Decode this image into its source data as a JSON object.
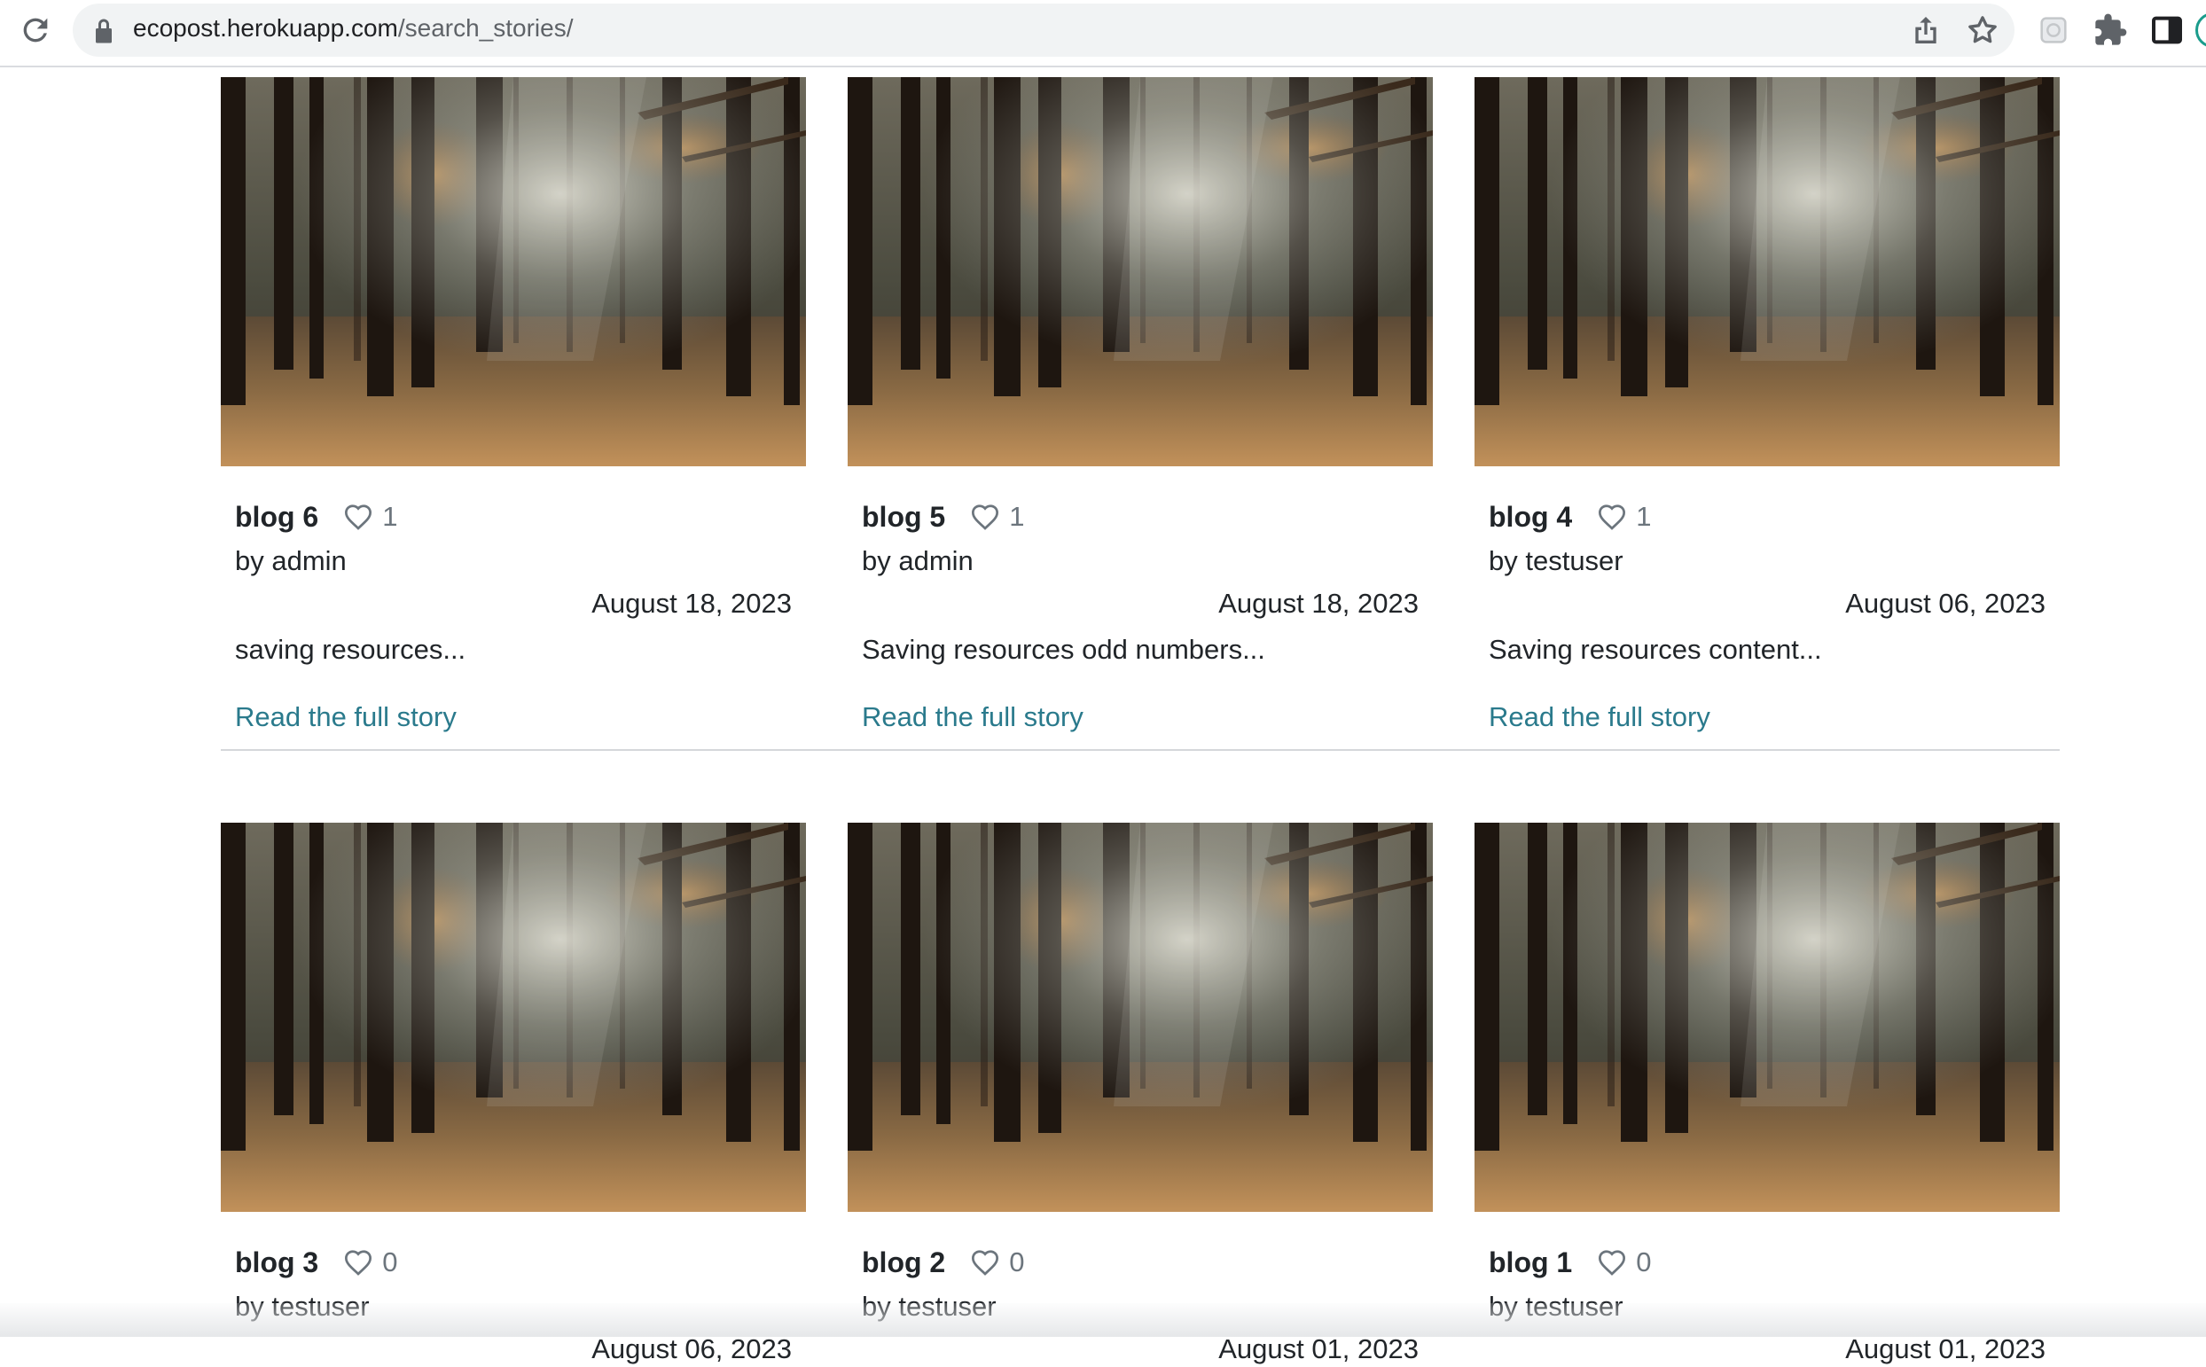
{
  "browser": {
    "url_host": "ecopost.herokuapp.com",
    "url_path": "/search_stories/"
  },
  "stories": [
    {
      "title": "blog 6",
      "likes": "1",
      "author": "by admin",
      "date": "August 18, 2023",
      "excerpt": "saving resources...",
      "link": "Read the full story"
    },
    {
      "title": "blog 5",
      "likes": "1",
      "author": "by admin",
      "date": "August 18, 2023",
      "excerpt": "Saving resources odd numbers...",
      "link": "Read the full story"
    },
    {
      "title": "blog 4",
      "likes": "1",
      "author": "by testuser",
      "date": "August 06, 2023",
      "excerpt": "Saving resources content...",
      "link": "Read the full story"
    },
    {
      "title": "blog 3",
      "likes": "0",
      "author": "by testuser",
      "date": "August 06, 2023",
      "excerpt": "",
      "link": ""
    },
    {
      "title": "blog 2",
      "likes": "0",
      "author": "by testuser",
      "date": "August 01, 2023",
      "excerpt": "",
      "link": ""
    },
    {
      "title": "blog 1",
      "likes": "0",
      "author": "by testuser",
      "date": "August 01, 2023",
      "excerpt": "",
      "link": ""
    }
  ],
  "icons": {
    "like": "heart-outline-icon",
    "reload": "reload-icon",
    "lock": "lock-icon",
    "share": "share-icon",
    "bookmark": "star-icon",
    "extensions": "puzzle-icon",
    "sidepanel": "side-panel-icon"
  },
  "colors": {
    "link": "#2a7a8c",
    "muted": "#6c757d"
  }
}
